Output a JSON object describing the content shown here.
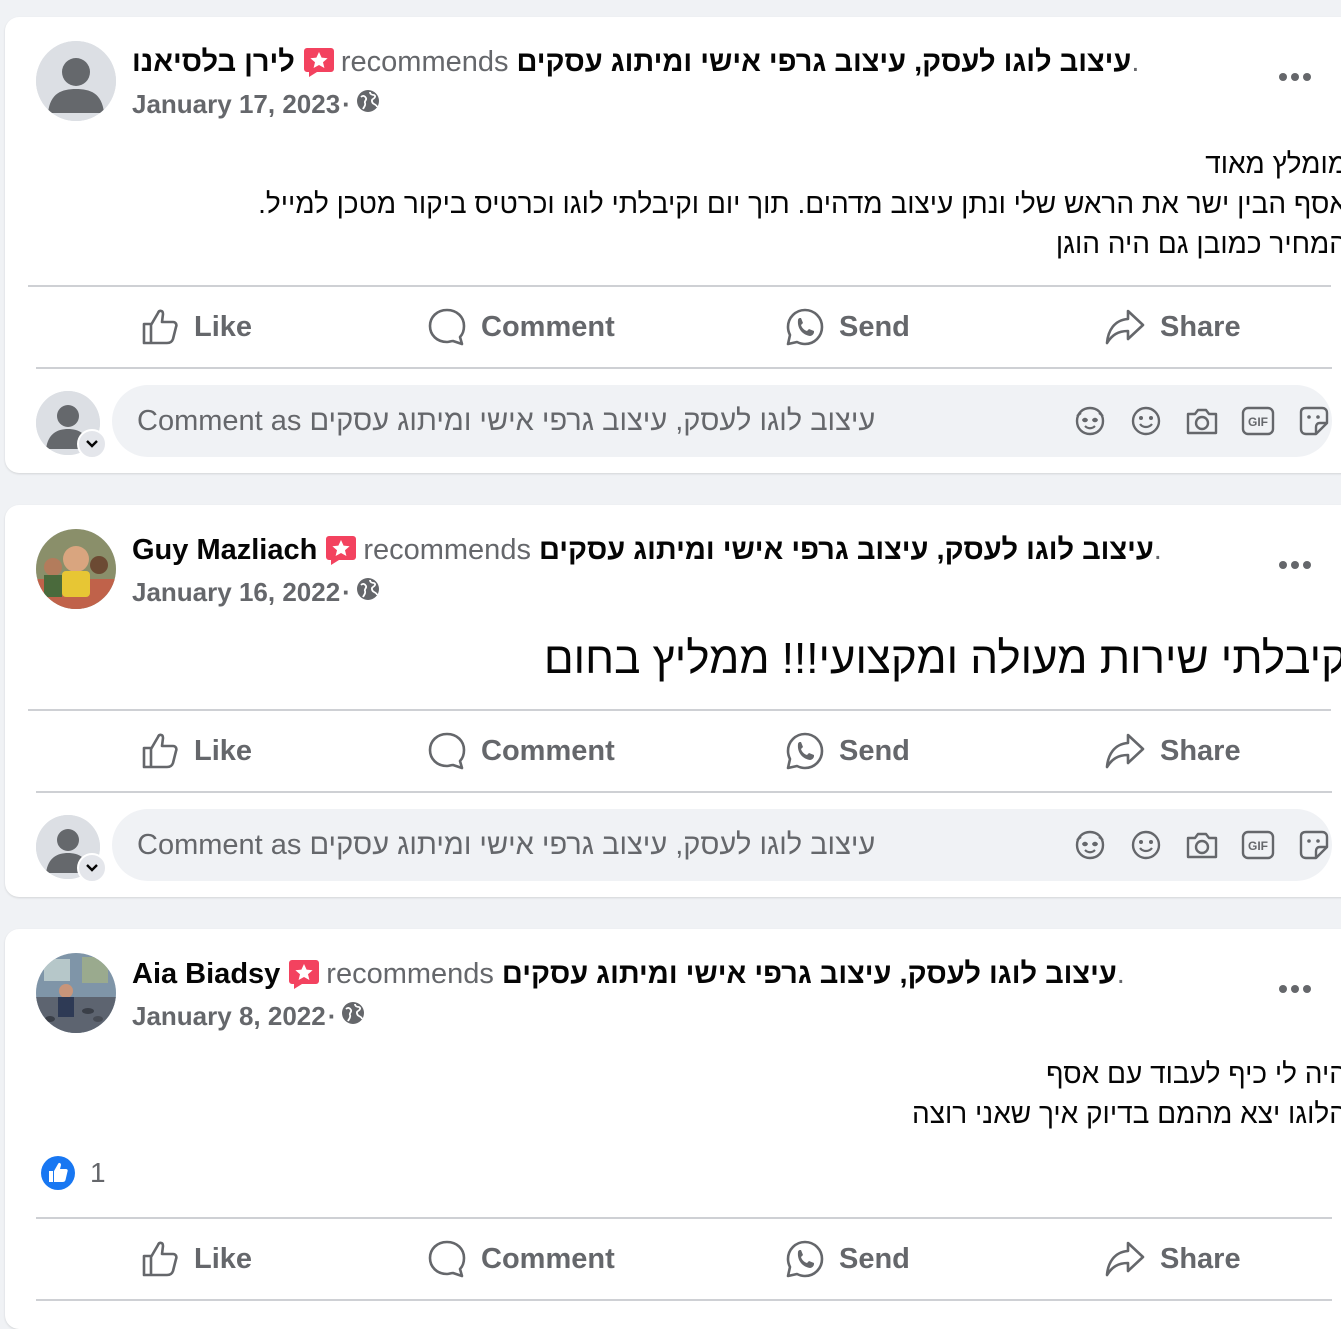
{
  "page_name": "עיצוב לוגו לעסק, עיצוב גרפי אישי ומיתוג עסקים",
  "recommends_label": "recommends",
  "actions": {
    "like": "Like",
    "comment": "Comment",
    "send": "Send",
    "share": "Share"
  },
  "composer_placeholder": "Comment as עיצוב לוגו לעסק, עיצוב גרפי אישי ומיתוג עסקים",
  "posts": [
    {
      "author": "לירן בלסיאנו",
      "date": "January 17, 2023",
      "body": [
        "מומלץ מאוד",
        "אסף הבין ישר את הראש שלי ונתן עיצוב מדהים. תוך יום וקיבלתי לוגו וכרטיס ביקור מטכן למייל.",
        "המחיר כמובן גם היה הוגן"
      ]
    },
    {
      "author": "Guy Mazliach",
      "date": "January 16, 2022",
      "body": [
        "קיבלתי שירות מעולה ומקצועי!!! ממליץ בחום"
      ]
    },
    {
      "author": "Aia Biadsy",
      "date": "January 8, 2022",
      "body": [
        "היה לי כיף לעבוד עם אסף",
        "הלוגו יצא מהמם בדיוק איך שאני רוצה"
      ],
      "reaction_count": "1"
    }
  ],
  "colors": {
    "background": "#f0f2f5",
    "card": "#ffffff",
    "secondary_text": "#65676b",
    "badge": "#f3425f",
    "like_blue": "#1877f2"
  },
  "icons": [
    "avatar-icon",
    "recommend-badge-icon",
    "globe-icon",
    "more-icon",
    "like-icon",
    "comment-icon",
    "send-icon",
    "share-icon",
    "avatar-icon",
    "sticker-icon",
    "emoji-icon",
    "camera-icon",
    "gif-icon",
    "avatar-sticker-icon"
  ]
}
